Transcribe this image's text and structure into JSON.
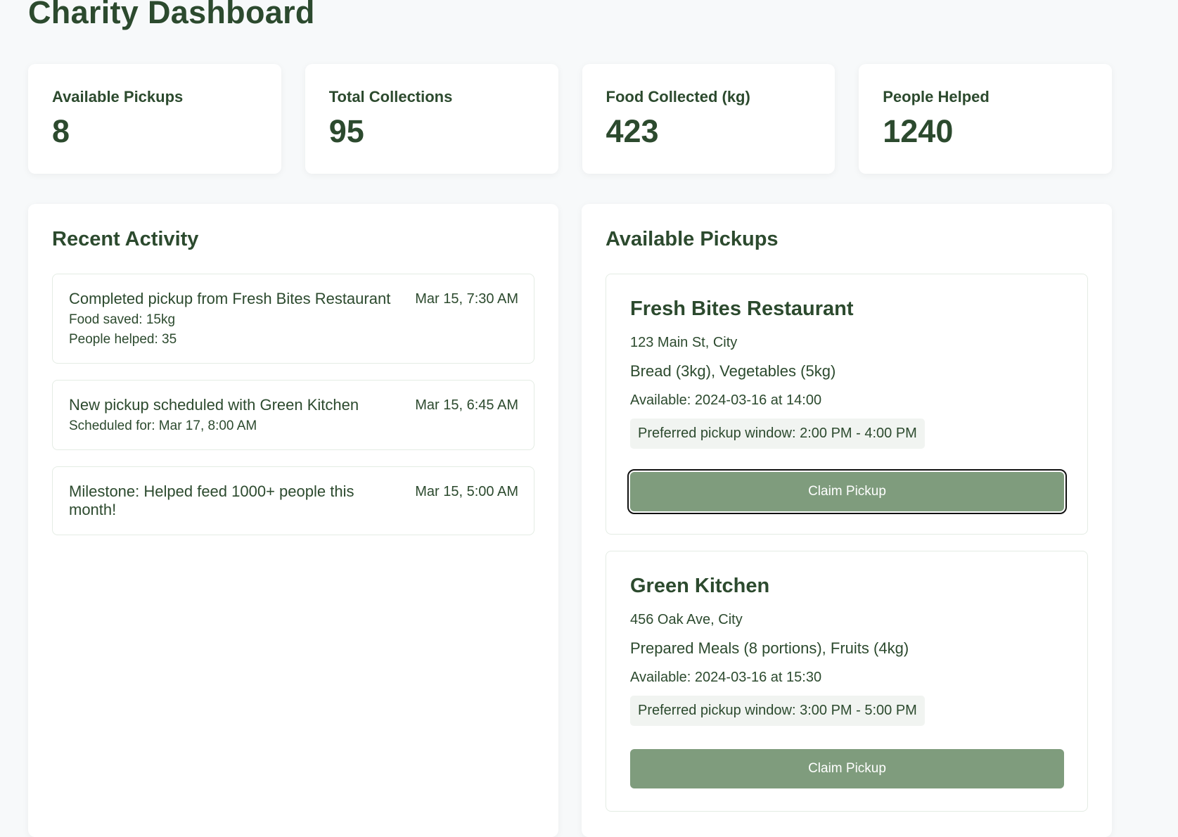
{
  "page": {
    "title": "Charity Dashboard"
  },
  "stats": [
    {
      "label": "Available Pickups",
      "value": "8"
    },
    {
      "label": "Total Collections",
      "value": "95"
    },
    {
      "label": "Food Collected (kg)",
      "value": "423"
    },
    {
      "label": "People Helped",
      "value": "1240"
    }
  ],
  "activity": {
    "title": "Recent Activity",
    "items": [
      {
        "text": "Completed pickup from Fresh Bites Restaurant",
        "time": "Mar 15, 7:30 AM",
        "details": [
          "Food saved: 15kg",
          "People helped: 35"
        ]
      },
      {
        "text": "New pickup scheduled with Green Kitchen",
        "time": "Mar 15, 6:45 AM",
        "details": [
          "Scheduled for: Mar 17, 8:00 AM"
        ]
      },
      {
        "text": "Milestone: Helped feed 1000+ people this month!",
        "time": "Mar 15, 5:00 AM",
        "details": []
      }
    ]
  },
  "pickups": {
    "title": "Available Pickups",
    "items": [
      {
        "name": "Fresh Bites Restaurant",
        "address": "123 Main St, City",
        "food": "Bread (3kg), Vegetables (5kg)",
        "available": "Available: 2024-03-16 at 14:00",
        "window": "Preferred pickup window: 2:00 PM - 4:00 PM",
        "button": "Claim Pickup"
      },
      {
        "name": "Green Kitchen",
        "address": "456 Oak Ave, City",
        "food": "Prepared Meals (8 portions), Fruits (4kg)",
        "available": "Available: 2024-03-16 at 15:30",
        "window": "Preferred pickup window: 3:00 PM - 5:00 PM",
        "button": "Claim Pickup"
      }
    ]
  }
}
